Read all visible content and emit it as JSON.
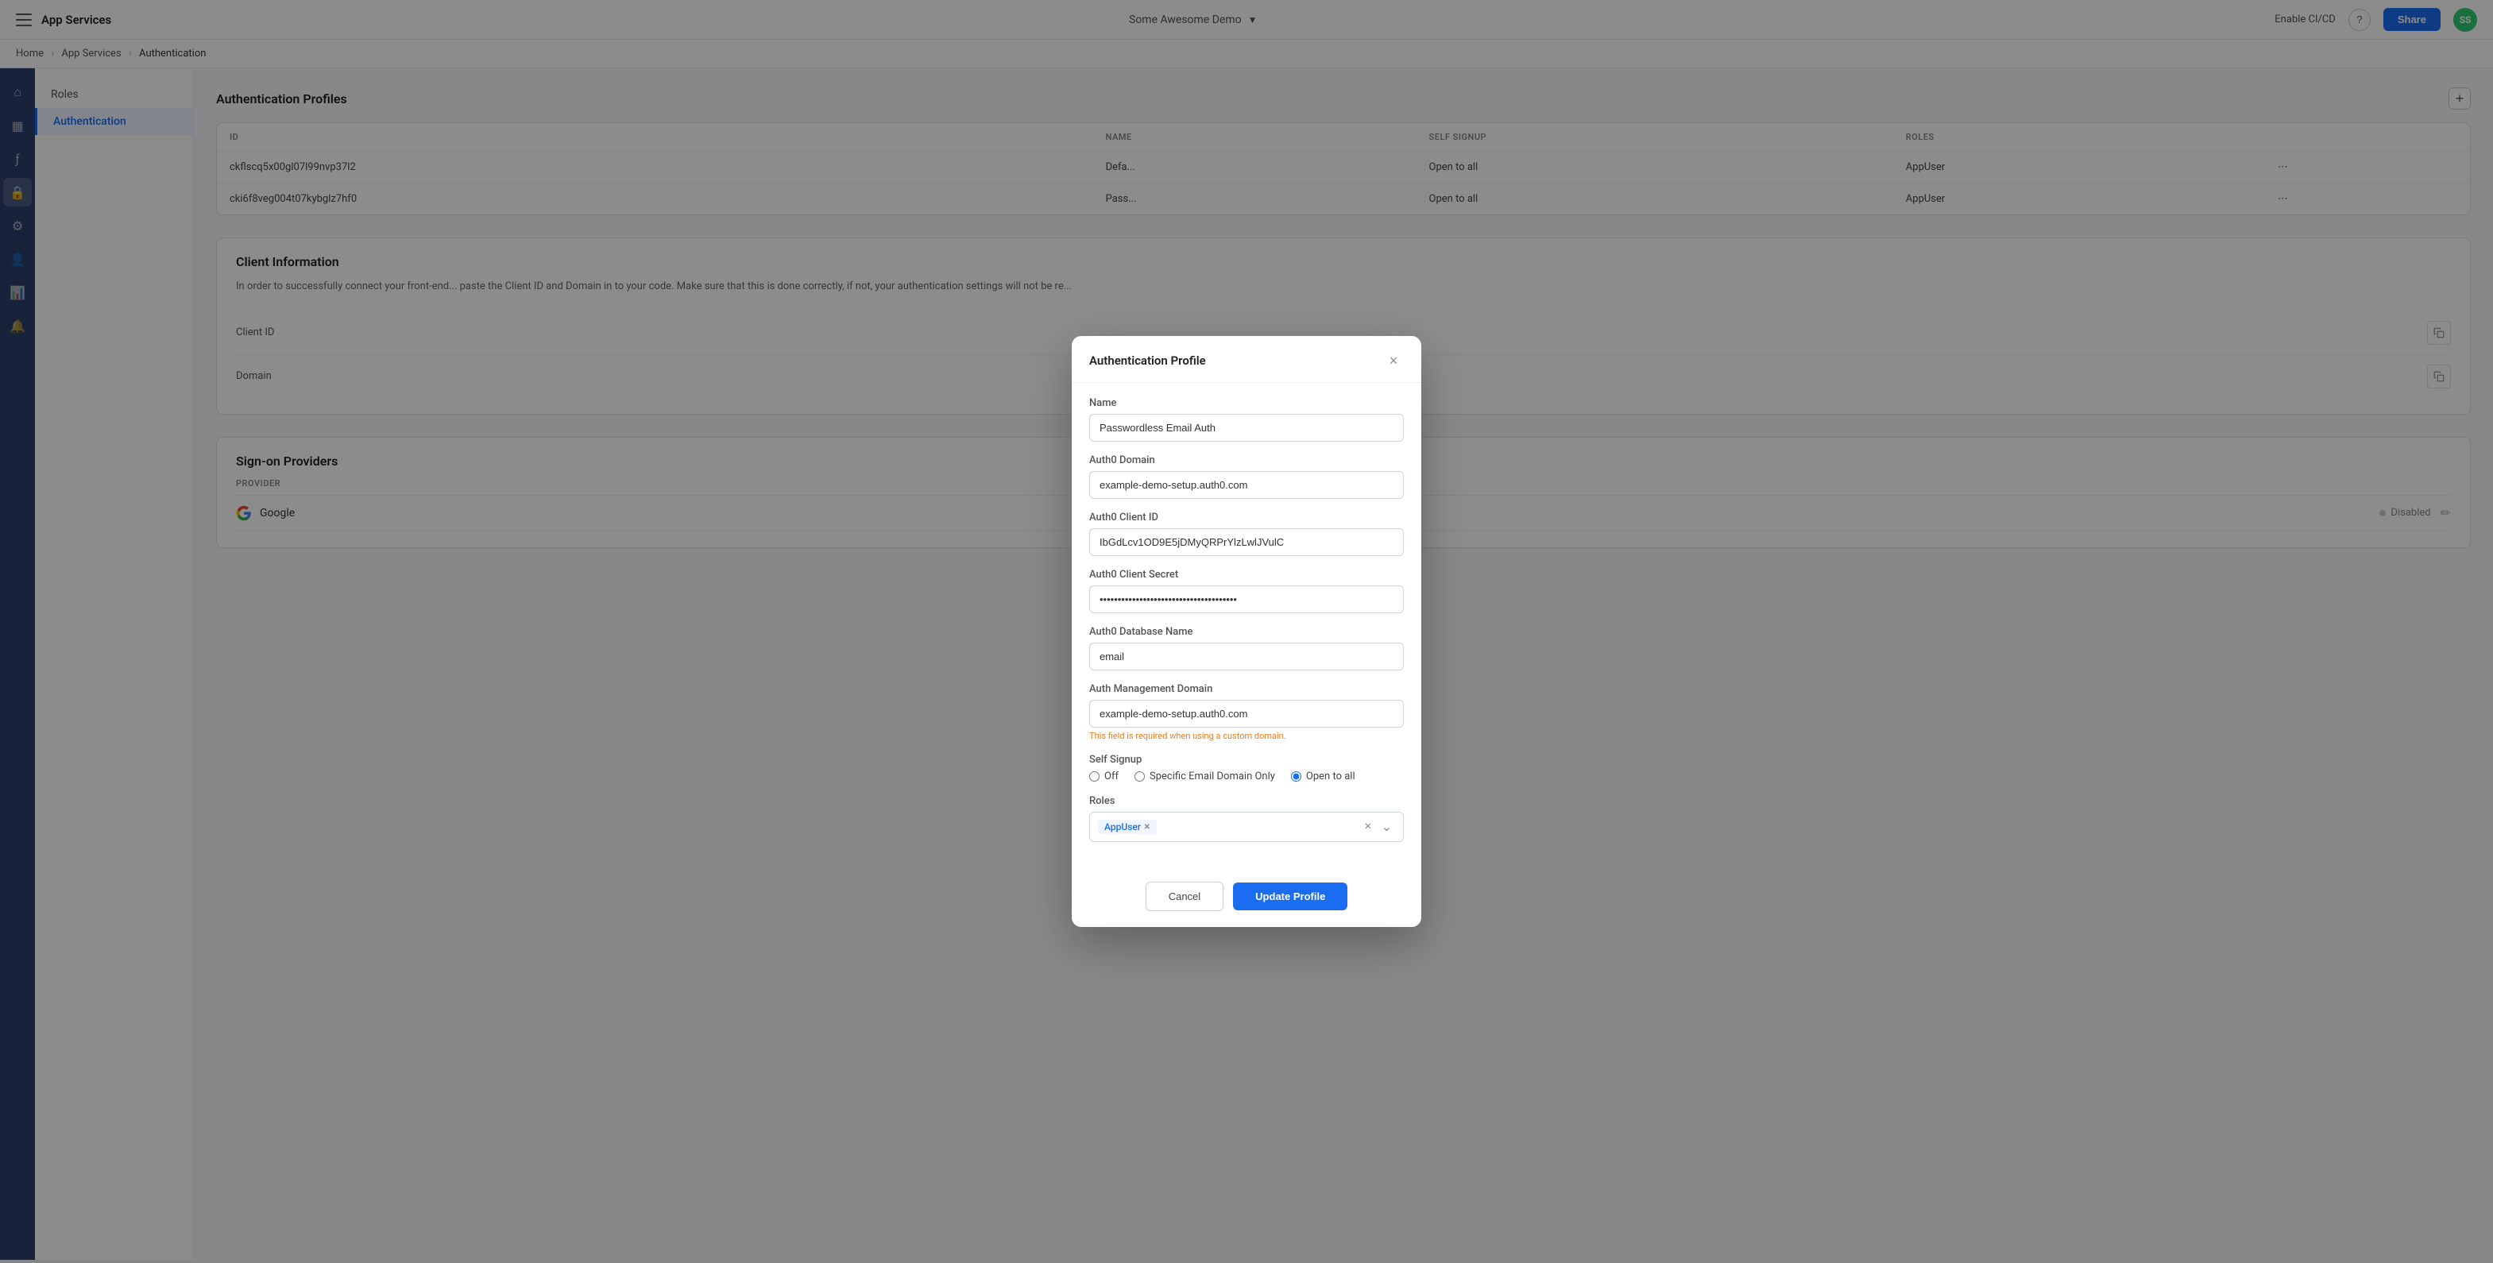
{
  "topNav": {
    "hamburger": "☰",
    "appTitle": "App Services",
    "demoName": "Some Awesome Demo",
    "dropdownArrow": "▼",
    "enableCICD": "Enable CI/CD",
    "helpLabel": "?",
    "shareLabel": "Share",
    "avatarInitials": "SS"
  },
  "breadcrumb": {
    "home": "Home",
    "appServices": "App Services",
    "current": "Authentication"
  },
  "sidebar": {
    "items": [
      {
        "label": "Roles",
        "active": false
      },
      {
        "label": "Authentication",
        "active": true
      }
    ]
  },
  "authProfiles": {
    "sectionTitle": "Authentication Profiles",
    "addBtn": "+",
    "table": {
      "columns": [
        "ID",
        "NAME",
        "SELF SIGNUP",
        "ROLES"
      ],
      "rows": [
        {
          "id": "ckflscq5x00gl07l99nvp37l2",
          "name": "Defa...",
          "selfSignup": "Open to all",
          "roles": "AppUser"
        },
        {
          "id": "cki6f8veg004t07kybglz7hf0",
          "name": "Pass...",
          "selfSignup": "Open to all",
          "roles": "AppUser"
        }
      ]
    }
  },
  "clientInfo": {
    "sectionTitle": "Client Information",
    "description": "In order to successfully connect your front-end... paste the Client ID and Domain in to your code. Make sure that this is done correctly, if not, your authentication settings will not be re...",
    "fields": [
      {
        "label": "Client ID"
      },
      {
        "label": "Domain"
      }
    ]
  },
  "signOnProviders": {
    "sectionTitle": "Sign-on Providers",
    "columns": [
      "PROVIDER"
    ],
    "rows": [
      {
        "name": "Google",
        "status": "Disabled"
      }
    ]
  },
  "modal": {
    "title": "Authentication Profile",
    "closeLabel": "×",
    "fields": {
      "name": {
        "label": "Name",
        "value": "Passwordless Email Auth",
        "placeholder": ""
      },
      "auth0Domain": {
        "label": "Auth0 Domain",
        "value": "example-demo-setup.auth0.com",
        "placeholder": ""
      },
      "auth0ClientId": {
        "label": "Auth0 Client ID",
        "value": "IbGdLcv1OD9E5jDMyQRPrYlzLwlJVulC",
        "placeholder": ""
      },
      "auth0ClientSecret": {
        "label": "Auth0 Client Secret",
        "value": "••••••••••••••••••••••••••••••••••••••••••••••••••••••••••••",
        "placeholder": ""
      },
      "auth0DatabaseName": {
        "label": "Auth0 Database Name",
        "value": "email",
        "placeholder": ""
      },
      "authManagementDomain": {
        "label": "Auth Management Domain",
        "value": "example-demo-setup.auth0.com",
        "placeholder": "",
        "hint": "This field is required when using a custom domain."
      }
    },
    "selfSignup": {
      "label": "Self Signup",
      "options": [
        {
          "label": "Off",
          "value": "off",
          "checked": false
        },
        {
          "label": "Specific Email Domain Only",
          "value": "specific",
          "checked": false
        },
        {
          "label": "Open to all",
          "value": "all",
          "checked": true
        }
      ]
    },
    "roles": {
      "label": "Roles",
      "tags": [
        "AppUser"
      ]
    },
    "cancelBtn": "Cancel",
    "updateBtn": "Update Profile"
  }
}
